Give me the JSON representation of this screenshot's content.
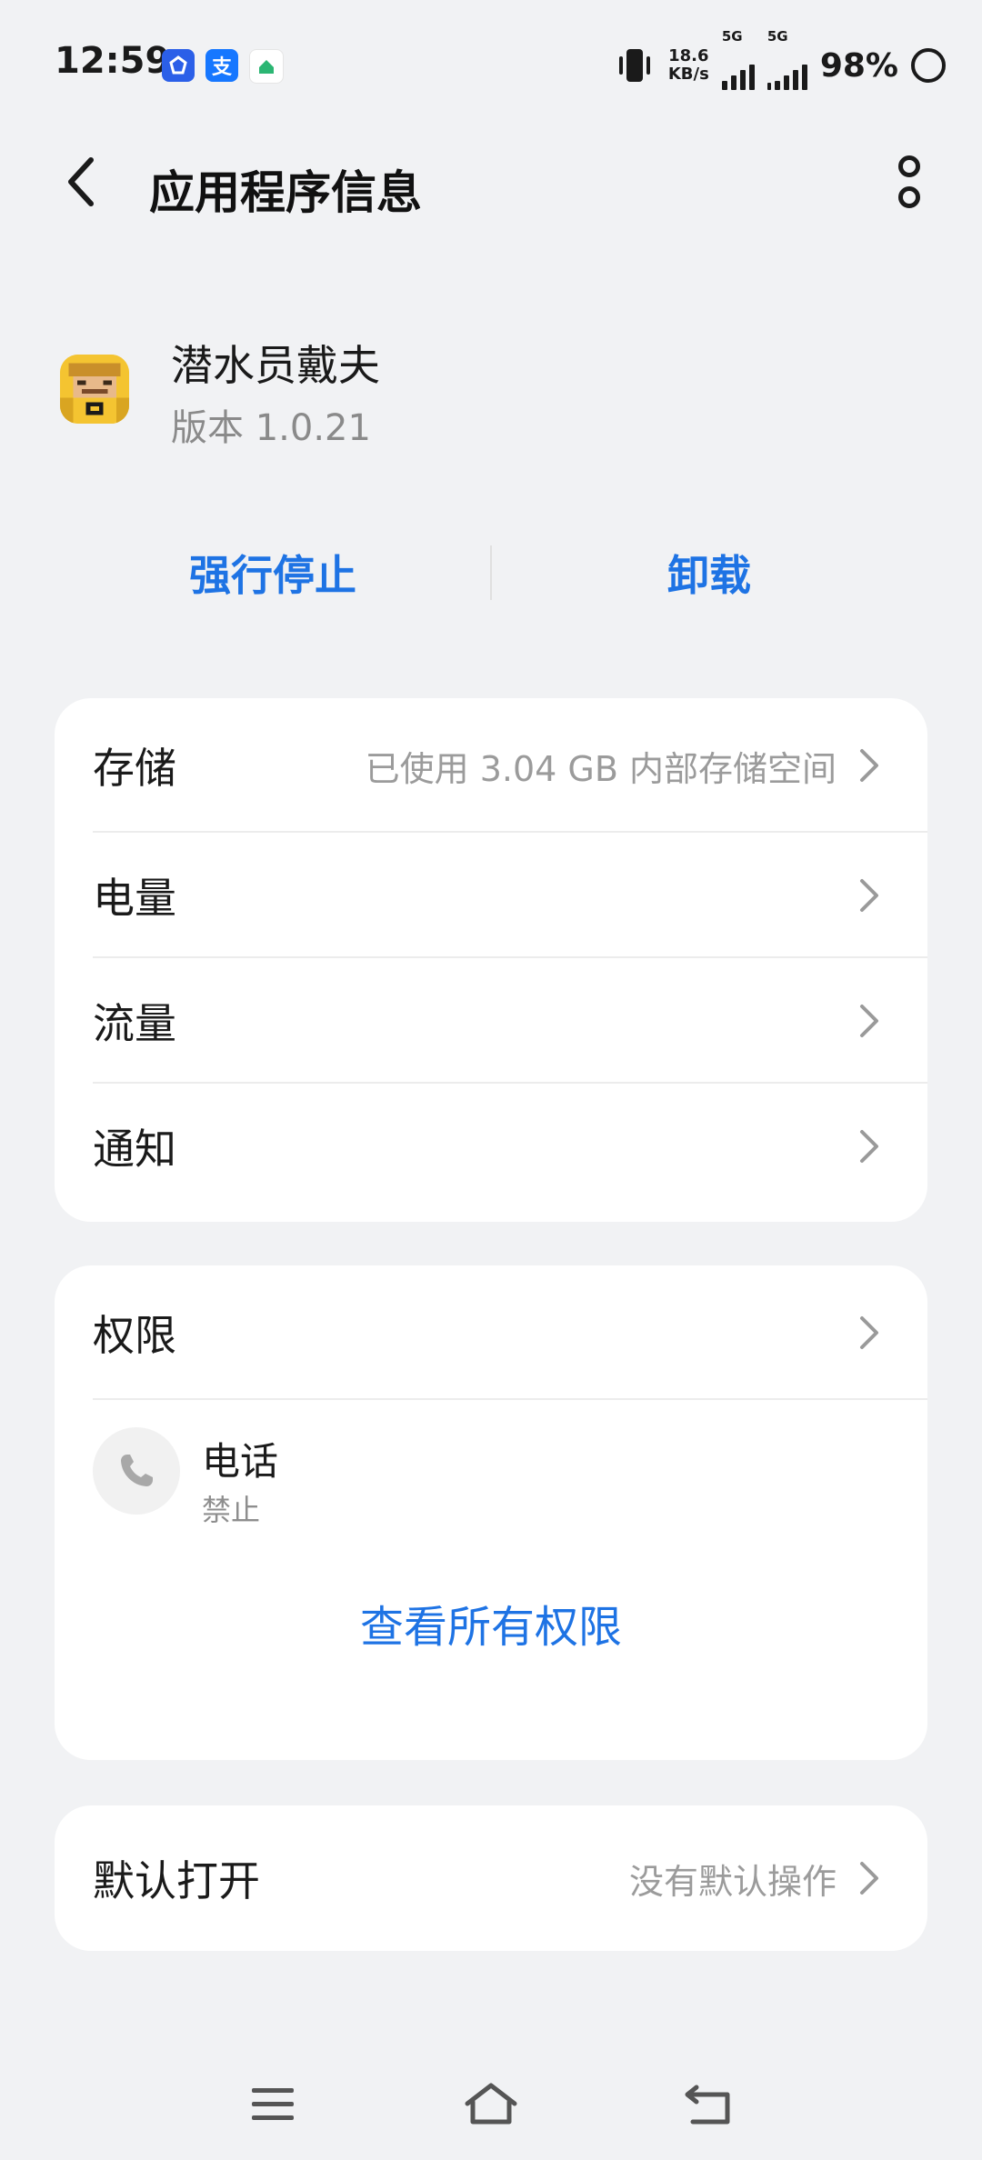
{
  "status_bar": {
    "time": "12:59",
    "net_speed_value": "18.6",
    "net_speed_unit": "KB/s",
    "sim1_label": "5G",
    "sim2_label": "5G",
    "battery": "98%",
    "app_icons": [
      {
        "name": "app-icon-blue",
        "color": "#2b5fe8"
      },
      {
        "name": "alipay-icon",
        "color": "#1677ff",
        "glyph": "支"
      },
      {
        "name": "airjuke-icon",
        "color": "#ffffff"
      }
    ]
  },
  "header": {
    "title": "应用程序信息"
  },
  "app": {
    "name": "潜水员戴夫",
    "version": "版本 1.0.21"
  },
  "actions": {
    "force_stop": "强行停止",
    "uninstall": "卸载"
  },
  "settings": [
    {
      "label": "存储",
      "value": "已使用 3.04 GB 内部存储空间"
    },
    {
      "label": "电量",
      "value": ""
    },
    {
      "label": "流量",
      "value": ""
    },
    {
      "label": "通知",
      "value": ""
    }
  ],
  "permissions": {
    "title": "权限",
    "items": [
      {
        "name": "电话",
        "status": "禁止"
      }
    ],
    "view_all": "查看所有权限"
  },
  "default_open": {
    "label": "默认打开",
    "value": "没有默认操作"
  },
  "colors": {
    "accent": "#1e73e4",
    "background": "#f1f2f4",
    "card": "#ffffff"
  }
}
